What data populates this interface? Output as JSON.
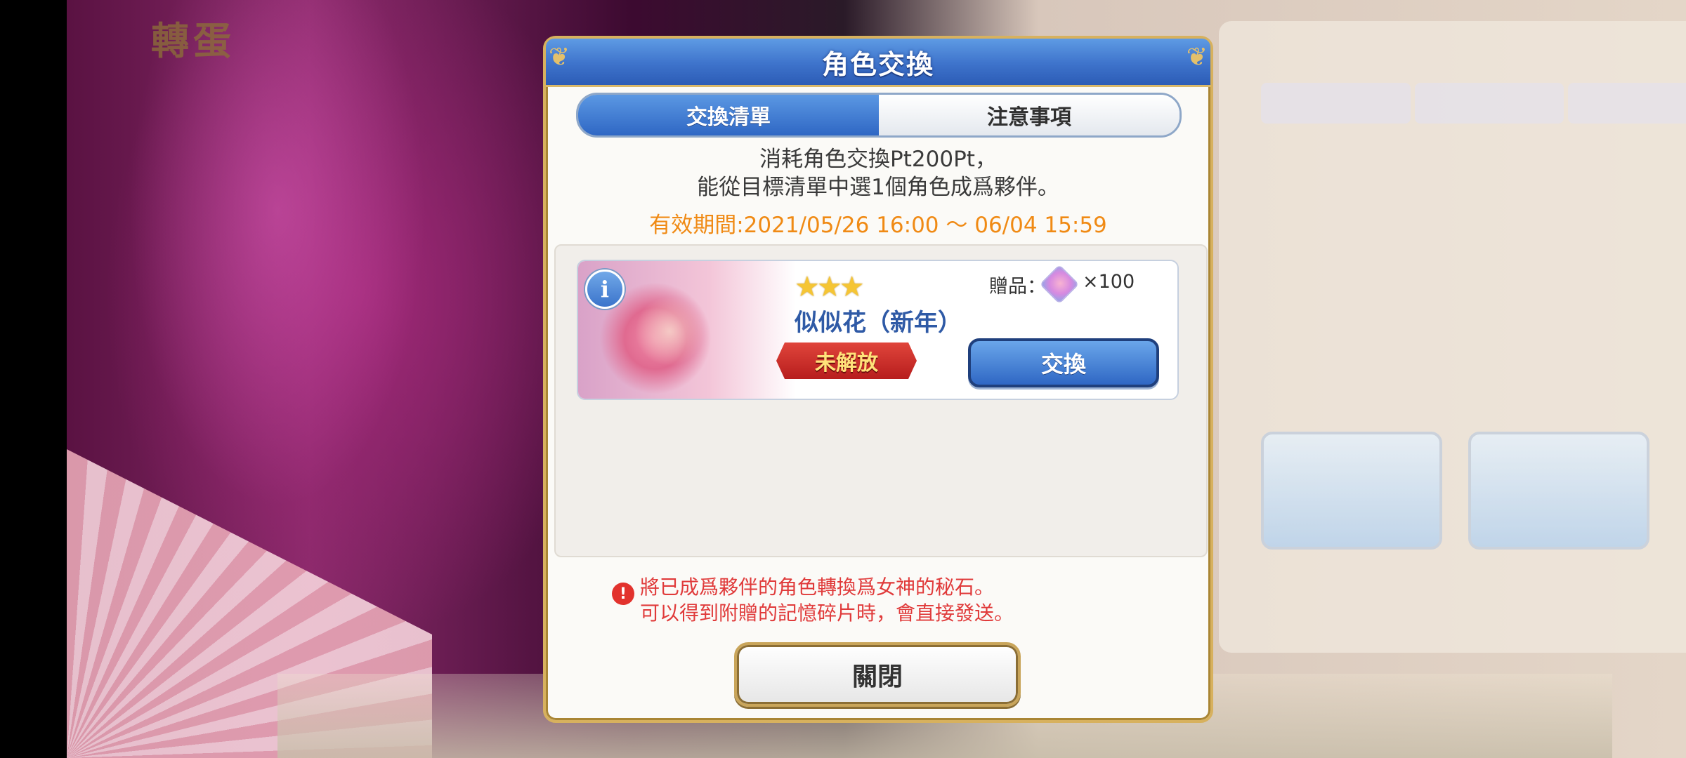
{
  "dialog": {
    "title": "角色交換",
    "tabs": [
      {
        "label": "交換清單",
        "active": true
      },
      {
        "label": "注意事項",
        "active": false
      }
    ],
    "description_line1": "消耗角色交換Pt200Pt，",
    "description_line2": "能從目標清單中選1個角色成爲夥伴。",
    "validity_period": "有效期間:2021/05/26 16:00 ～ 06/04 15:59",
    "items": [
      {
        "stars": "★★★",
        "name": "似似花（新年）",
        "status_badge": "未解放",
        "gift_label": "贈品：",
        "gift_icon": "memory-shard-icon",
        "gift_quantity": "×100",
        "exchange_button": "交換"
      }
    ],
    "notice_line1": "將已成爲夥伴的角色轉換爲女神的秘石。",
    "notice_line2": "可以得到附贈的記憶碎片時，會直接發送。",
    "close_button": "關閉"
  },
  "background": {
    "title": "轉蛋"
  },
  "colors": {
    "header_blue": "#3e73cb",
    "period_orange": "#f08a14",
    "notice_red": "#e03a3a",
    "gold_border": "#d7b15e"
  }
}
